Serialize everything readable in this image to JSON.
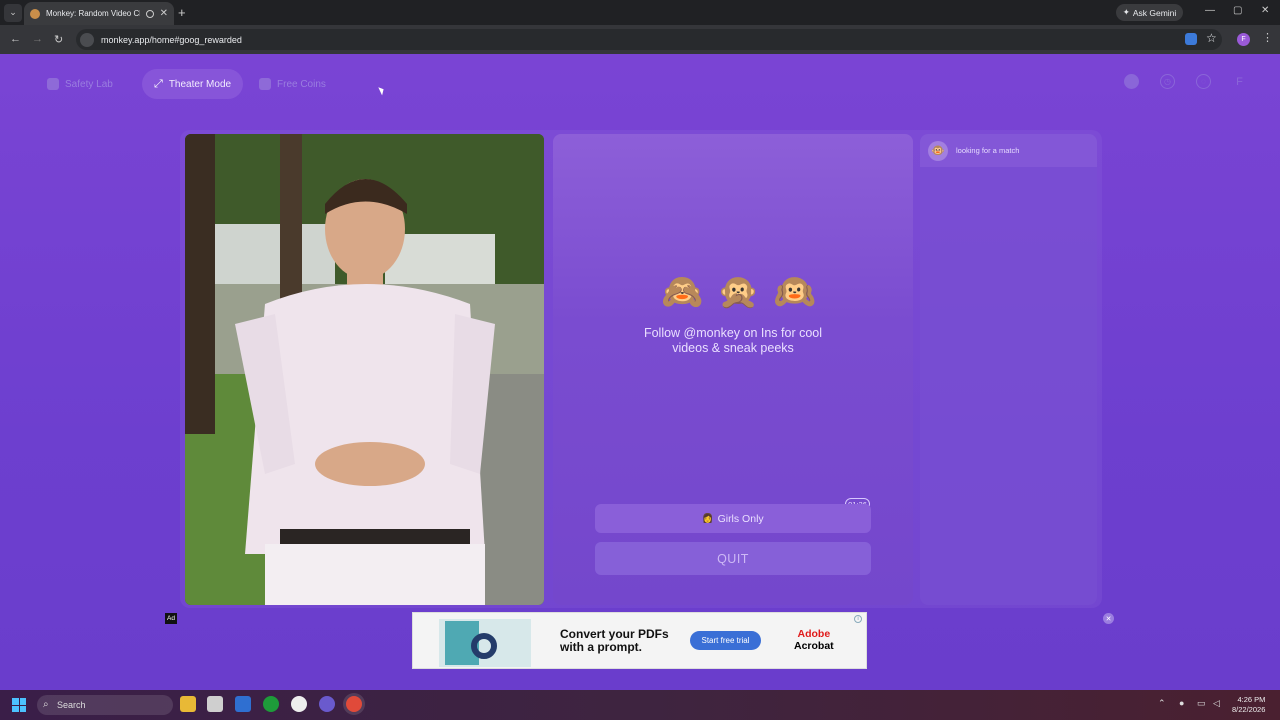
{
  "browser": {
    "tab_title": "Monkey: Random Video Ch",
    "new_tab": "+",
    "ask_gemini": "Ask Gemini",
    "url": "monkey.app/home#goog_rewarded",
    "profile_initial": "F"
  },
  "topnav": {
    "safety_lab": "Safety Lab",
    "theater_mode": "Theater Mode",
    "free_coins": "Free Coins",
    "profile_initial": "F"
  },
  "center": {
    "emojis": [
      "🙈",
      "🙊",
      "🙉"
    ],
    "follow_line1": "Follow @monkey on Ins for cool",
    "follow_line2": "videos & sneak peeks",
    "timer": "01:26",
    "girls_only": "Girls Only",
    "girls_icon": "👩",
    "quit": "QUIT"
  },
  "chat": {
    "status": "looking for a match",
    "avatar": "🐵"
  },
  "ad": {
    "badge": "Ad",
    "headline_line1": "Convert your PDFs",
    "headline_line2": "with a prompt.",
    "cta": "Start free trial",
    "brand_line1": "Adobe",
    "brand_line2": "Acrobat",
    "close": "✕"
  },
  "taskbar": {
    "search": "Search",
    "time": "4:26 PM",
    "date": "8/22/2026"
  }
}
